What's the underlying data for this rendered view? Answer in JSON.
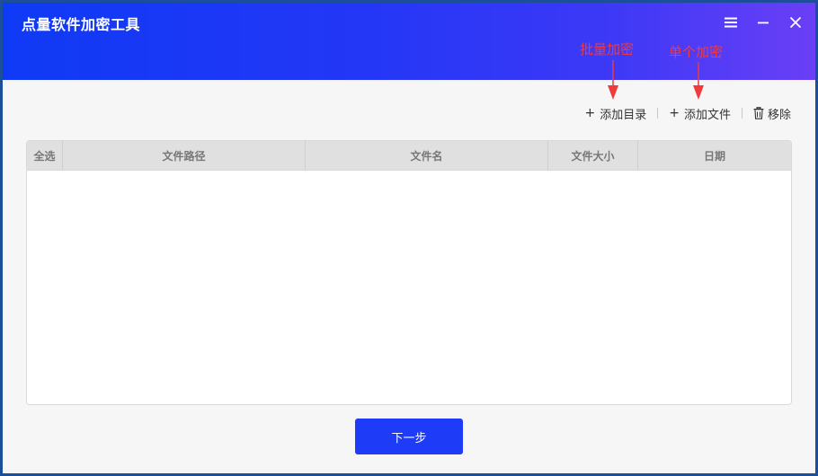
{
  "window": {
    "title": "点量软件加密工具",
    "controls": {
      "menu_icon": "menu-icon",
      "minimize_icon": "minimize-icon",
      "close_icon": "close-icon"
    }
  },
  "annotations": {
    "batch": "批量加密",
    "single": "单个加密",
    "color": "#ef3b3b"
  },
  "toolbar": {
    "add_dir": "添加目录",
    "add_file": "添加文件",
    "remove": "移除",
    "plus_glyph": "+"
  },
  "table": {
    "columns": [
      "全选",
      "文件路径",
      "文件名",
      "文件大小",
      "日期"
    ],
    "rows": []
  },
  "footer": {
    "next_label": "下一步"
  },
  "colors": {
    "accent": "#1e3cf7",
    "title_gradient_start": "#0f3af5",
    "title_gradient_end": "#6a3ff6",
    "window_border": "#1c4f9a"
  }
}
